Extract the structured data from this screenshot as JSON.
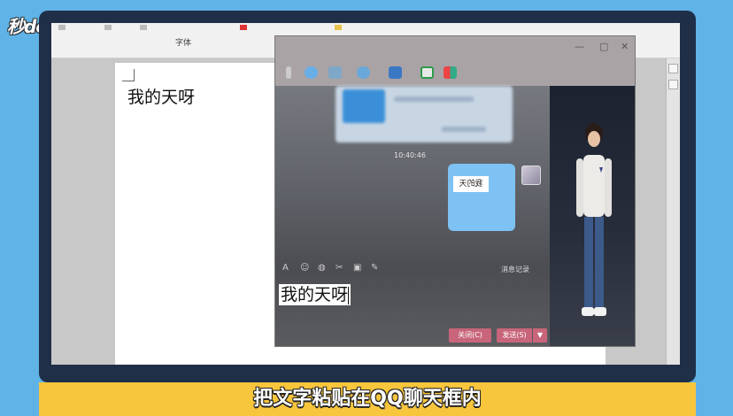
{
  "watermark": {
    "logo_text": "秒dong视频"
  },
  "word": {
    "ribbon_font_group": "字体",
    "document_text": "我的天呀"
  },
  "qq": {
    "timestamp": "10:40:46",
    "bubble_text": "我的天",
    "history_label": "消息记录",
    "input_text": "我的天呀",
    "close_button": "关闭(C)",
    "send_button": "发送(S)",
    "send_dropdown": "▼"
  },
  "caption": {
    "text": "把文字粘贴在QQ聊天框内"
  },
  "colors": {
    "background": "#5fb3e6",
    "caption_bar": "#f8c63c",
    "bubble": "#7ec2f4",
    "qq_buttons": "#c8657a"
  },
  "icons": [
    "minimize-icon",
    "maximize-icon",
    "close-icon",
    "screenshot-icon",
    "app-icon",
    "emoji-icon",
    "scissors-icon"
  ]
}
